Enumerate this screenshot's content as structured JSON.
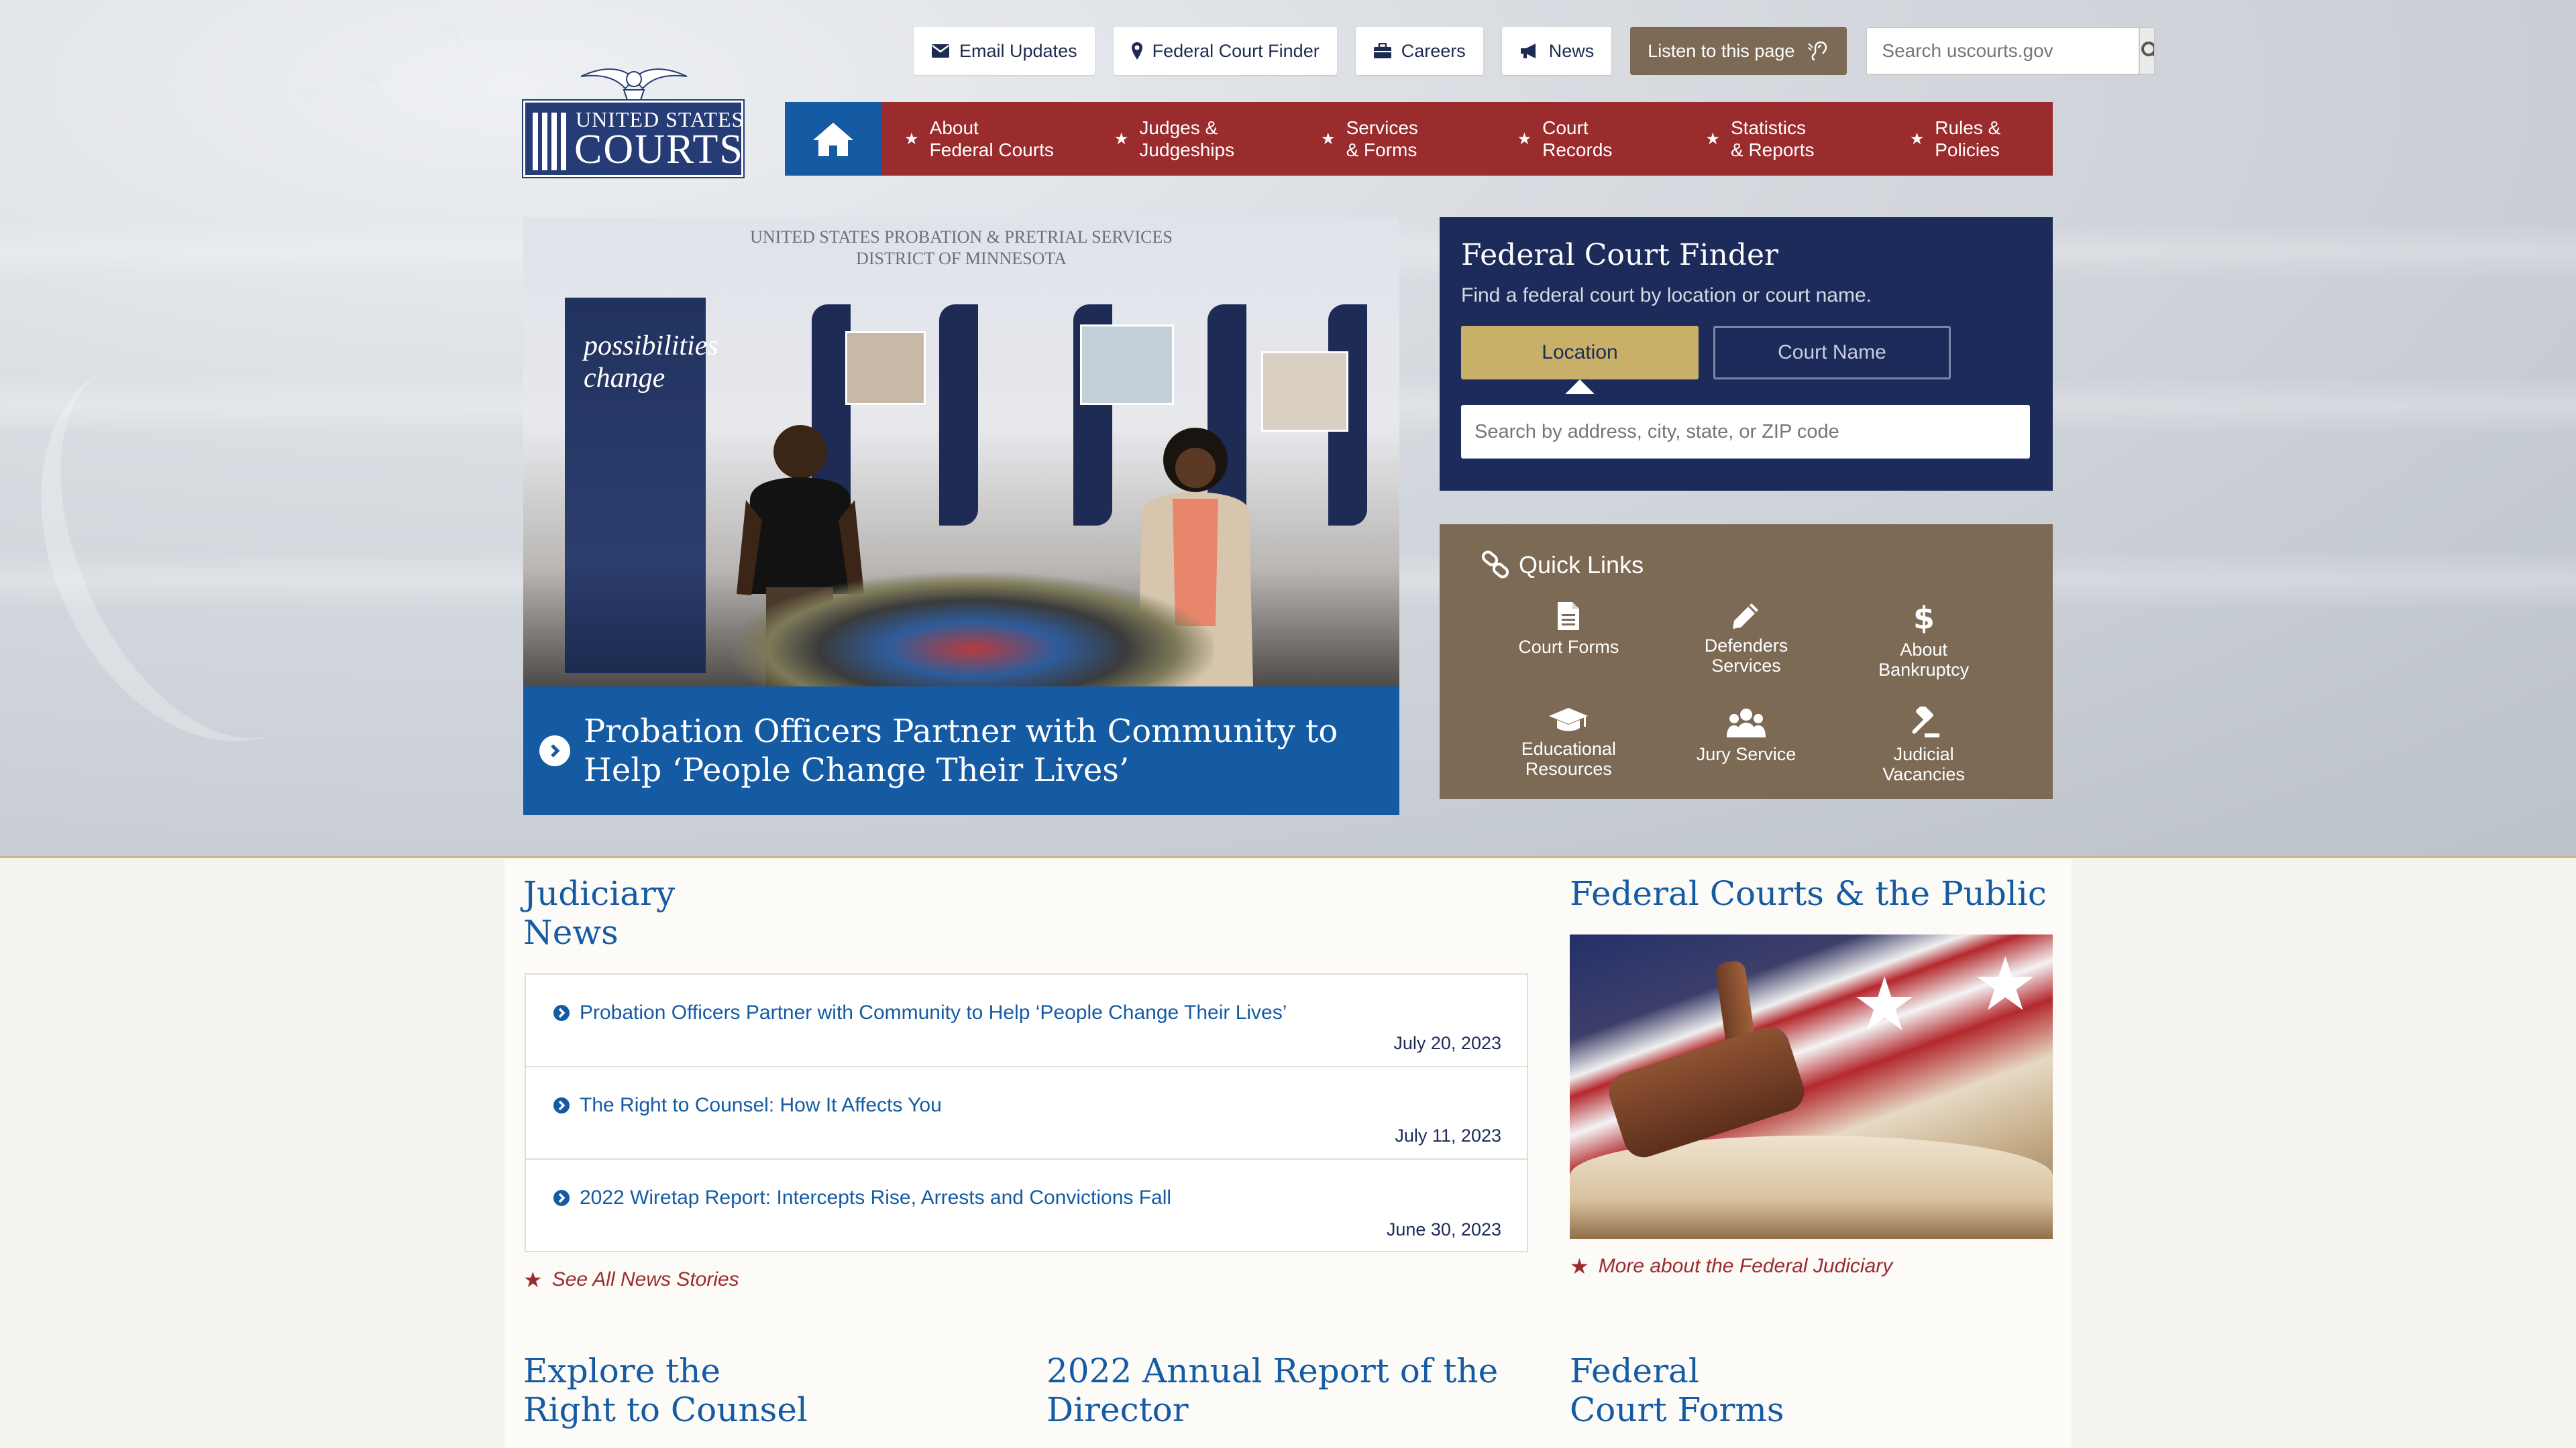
{
  "util": {
    "email_updates": "Email Updates",
    "court_finder": "Federal Court Finder",
    "careers": "Careers",
    "news": "News",
    "listen": "Listen to this page",
    "search_placeholder": "Search uscourts.gov"
  },
  "logo": {
    "line1": "UNITED STATES",
    "line2": "COURTS"
  },
  "nav": [
    {
      "l1": "About",
      "l2": "Federal Courts"
    },
    {
      "l1": "Judges &",
      "l2": "Judgeships"
    },
    {
      "l1": "Services",
      "l2": "& Forms"
    },
    {
      "l1": "Court",
      "l2": "Records"
    },
    {
      "l1": "Statistics",
      "l2": "& Reports"
    },
    {
      "l1": "Rules &",
      "l2": "Policies"
    }
  ],
  "slide": {
    "wall_line1": "UNITED STATES PROBATION & PRETRIAL SERVICES",
    "wall_line2": "DISTRICT OF MINNESOTA",
    "banner_l1": "possibilities",
    "banner_l2": "change",
    "caption_l1": "Probation Officers Partner with Community to",
    "caption_l2": "Help ‘People Change Their Lives’"
  },
  "finder": {
    "title": "Federal Court Finder",
    "subtitle": "Find a federal court by location or court name.",
    "tab_location": "Location",
    "tab_name": "Court Name",
    "placeholder": "Search by address, city, state, or ZIP code"
  },
  "quick": {
    "title": "Quick Links",
    "items": [
      {
        "l1": "Court Forms",
        "l2": "",
        "icon": "document-icon"
      },
      {
        "l1": "Defenders",
        "l2": "Services",
        "icon": "pencil-icon"
      },
      {
        "l1": "About",
        "l2": "Bankruptcy",
        "icon": "dollar-icon"
      },
      {
        "l1": "Educational",
        "l2": "Resources",
        "icon": "graduation-cap-icon"
      },
      {
        "l1": "Jury Service",
        "l2": "",
        "icon": "group-icon"
      },
      {
        "l1": "Judicial",
        "l2": "Vacancies",
        "icon": "gavel-icon"
      }
    ]
  },
  "judiciary_news": {
    "title_l1": "Judiciary",
    "title_l2": "News",
    "items": [
      {
        "title": "Probation Officers Partner with Community to Help ‘People Change Their Lives’",
        "date": "July 20, 2023"
      },
      {
        "title": "The Right to Counsel: How It Affects You",
        "date": "July 11, 2023"
      },
      {
        "title": "2022 Wiretap Report: Intercepts Rise, Arrests and Convictions Fall",
        "date": "June 30, 2023"
      }
    ],
    "see_all": "See All News Stories"
  },
  "public": {
    "title": "Federal Courts & the Public",
    "more": "More about the Federal Judiciary"
  },
  "bottom": {
    "explore_l1": "Explore the",
    "explore_l2": "Right to Counsel",
    "annual_l1": "2022 Annual Report of the",
    "annual_l2": "Director",
    "forms_l1": "Federal",
    "forms_l2": "Court Forms"
  },
  "colors": {
    "nav_red": "#9b2c2e",
    "home_blue": "#145ba4",
    "navy": "#1c2b5a",
    "gold": "#c9b068",
    "brown": "#7c6a55"
  }
}
